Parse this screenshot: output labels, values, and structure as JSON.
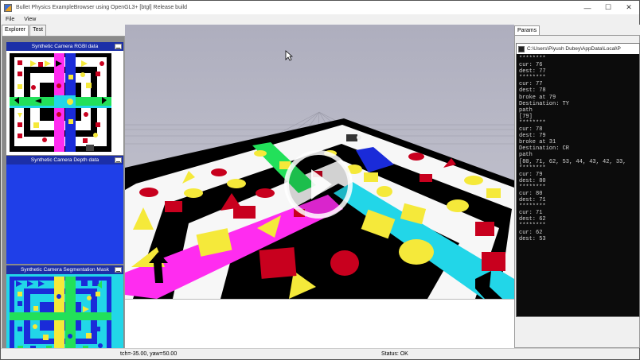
{
  "window": {
    "title": "Bullet Physics ExampleBrowser using OpenGL3+ [btgl] Release build",
    "controls": {
      "minimize": "—",
      "maximize": "☐",
      "close": "✕"
    }
  },
  "menu": {
    "items": [
      "File",
      "View"
    ]
  },
  "left_panel": {
    "tabs": [
      "Explorer",
      "Test"
    ],
    "cameras": [
      {
        "title": "Synthetic Camera RGBl data"
      },
      {
        "title": "Synthetic Camera Depth data"
      },
      {
        "title": "Synthetic Camera Segmentation Mask"
      }
    ]
  },
  "right_panel": {
    "tab": "Params",
    "console_title": "C:\\Users\\Piyush Dubey\\AppData\\Local\\P",
    "console_lines": [
      "********",
      "cur: 76",
      "dest: 77",
      "********",
      "cur: 77",
      "dest: 78",
      "broke at 79",
      "Destination: TY",
      "path",
      "[79]",
      "********",
      "cur: 78",
      "dest: 79",
      "broke at 31",
      "Destination: CR",
      "path",
      "[80, 71, 62, 53, 44, 43, 42, 33,",
      "********",
      "cur: 79",
      "dest: 80",
      "********",
      "cur: 80",
      "dest: 71",
      "********",
      "cur: 71",
      "dest: 62",
      "********",
      "cur: 62",
      "dest: 53"
    ]
  },
  "status": {
    "left": "tch=-35.00, yaw=50.00",
    "right": "Status: OK"
  },
  "colors": {
    "camera_title_bar": "#1c2fa8",
    "depth_fill": "#1f3fe8",
    "segmentation_bg": "#22d6e8"
  }
}
